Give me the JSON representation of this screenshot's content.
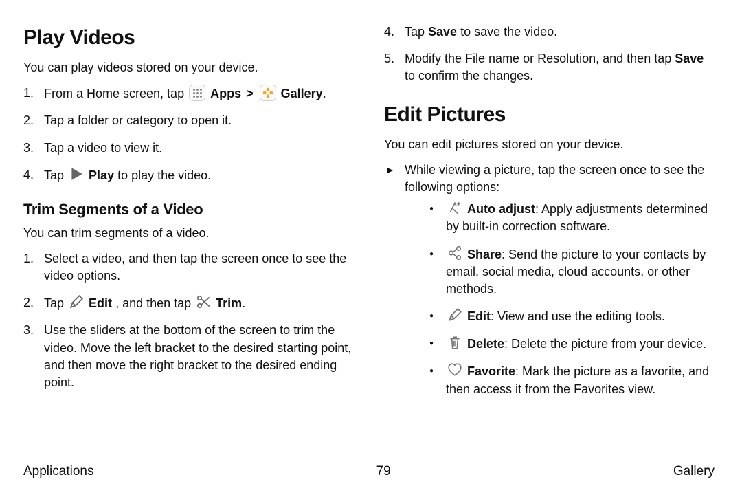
{
  "left": {
    "h1": "Play Videos",
    "intro": "You can play videos stored on your device.",
    "step1a": "From a Home screen, tap ",
    "apps": "Apps",
    "gt": ">",
    "gallery": "Gallery",
    "step2": "Tap a folder or category to open it.",
    "step3": "Tap a video to view it.",
    "step4a": "Tap ",
    "step4b": "Play",
    "step4c": " to play the video.",
    "h2": "Trim Segments of a Video",
    "intro2": "You can trim segments of a video.",
    "t1": "Select a video, and then tap the screen once to see the video options.",
    "t2a": "Tap ",
    "t2b": "Edit",
    "t2c": ", and then tap ",
    "t2d": "Trim",
    "t3": "Use the sliders at the bottom of the screen to trim the video. Move the left bracket to the desired starting point, and then move the right bracket to the desired ending point."
  },
  "right": {
    "s4a": "Tap ",
    "s4b": "Save",
    "s4c": " to save the video.",
    "s5a": "Modify the File name or Resolution, and then tap ",
    "s5b": "Save",
    "s5c": " to confirm the changes.",
    "h1": "Edit Pictures",
    "intro": "You can edit pictures stored on your device.",
    "arrow": "While viewing a picture, tap the screen once to see the following options:",
    "auto_b": "Auto adjust",
    "auto_t": ": Apply adjustments determined by built-in correction software.",
    "share_b": "Share",
    "share_t": ": Send the picture to your contacts by email, social media, cloud accounts, or other methods.",
    "edit_b": "Edit",
    "edit_t": ": View and use the editing tools.",
    "del_b": "Delete",
    "del_t": ": Delete the picture from your device.",
    "fav_b": "Favorite",
    "fav_t": ": Mark the picture as a favorite, and then access it from the Favorites view."
  },
  "footer": {
    "left": "Applications",
    "center": "79",
    "right": "Gallery"
  }
}
